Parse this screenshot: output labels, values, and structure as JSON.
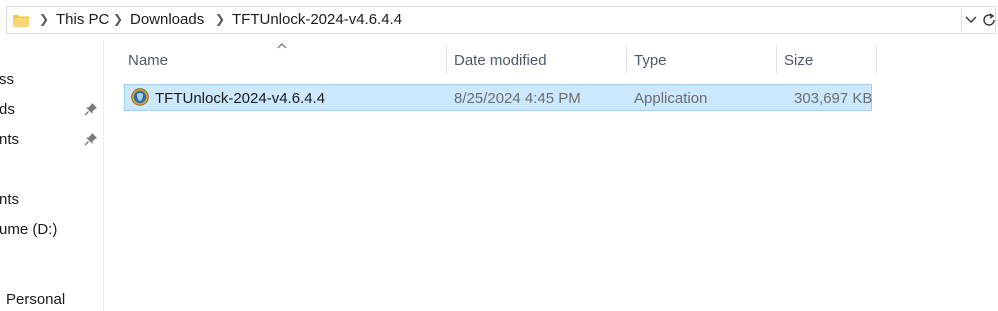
{
  "address_bar": {
    "breadcrumbs": [
      "This PC",
      "Downloads",
      "TFTUnlock-2024-v4.6.4.4"
    ]
  },
  "nav_pane": {
    "items": [
      "ss",
      "ds",
      "nts",
      "nts",
      "ume (D:)",
      "Personal"
    ]
  },
  "columns": {
    "name": "Name",
    "date_modified": "Date modified",
    "type": "Type",
    "size": "Size"
  },
  "files": [
    {
      "name": "TFTUnlock-2024-v4.6.4.4",
      "date_modified": "8/25/2024 4:45 PM",
      "type": "Application",
      "size": "303,697 KB",
      "selected": true,
      "icon": "app-shield-icon"
    }
  ],
  "colors": {
    "selection_bg": "#cce8ff",
    "selection_border": "#99d1ff",
    "header_text": "#4c5a6b"
  }
}
